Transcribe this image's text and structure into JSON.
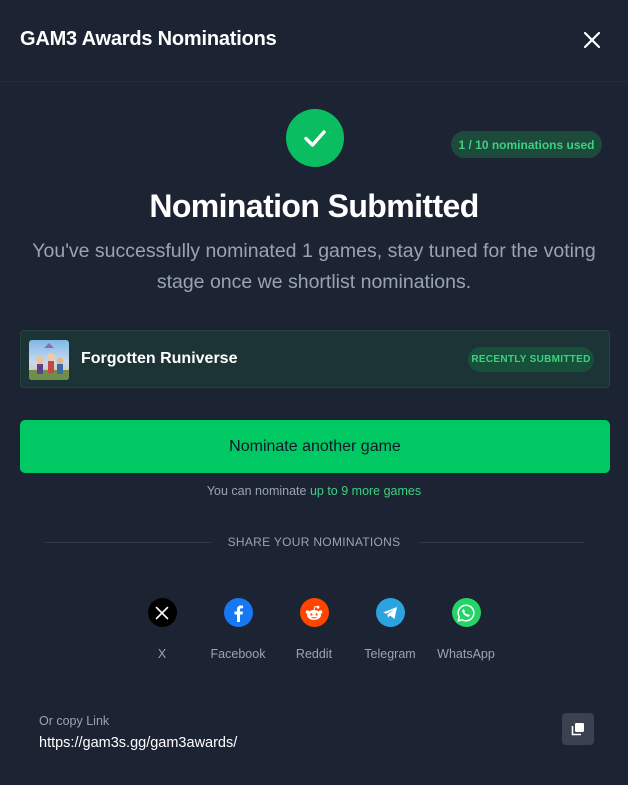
{
  "header": {
    "title": "GAM3 Awards Nominations",
    "close_icon": "close-icon"
  },
  "status": {
    "icon": "check-icon",
    "usage_badge": "1 / 10 nominations used",
    "title": "Nomination Submitted",
    "subtitle": "You've successfully nominated 1 games, stay tuned for the voting stage once we shortlist nominations."
  },
  "game": {
    "name": "Forgotten Runiverse",
    "badge": "RECENTLY SUBMITTED"
  },
  "nominate_button": {
    "label": "Nominate another game"
  },
  "remaining": {
    "prefix": "You can nominate ",
    "highlight": "up to 9 more games"
  },
  "share": {
    "heading": "SHARE YOUR NOMINATIONS",
    "items": [
      {
        "label": "X",
        "icon": "x-icon",
        "color": "#000000"
      },
      {
        "label": "Facebook",
        "icon": "facebook-icon",
        "color": "#1877f2"
      },
      {
        "label": "Reddit",
        "icon": "reddit-icon",
        "color": "#ff4500"
      },
      {
        "label": "Telegram",
        "icon": "telegram-icon",
        "color": "#2aa3df"
      },
      {
        "label": "WhatsApp",
        "icon": "whatsapp-icon",
        "color": "#25d366"
      }
    ]
  },
  "copy_link": {
    "label": "Or copy Link",
    "url": "https://gam3s.gg/gam3awards/",
    "icon": "copy-icon"
  },
  "colors": {
    "background": "#1c2333",
    "accent_green": "#00c964",
    "badge_text": "#3fd07f",
    "muted_text": "#9aa3b6"
  }
}
